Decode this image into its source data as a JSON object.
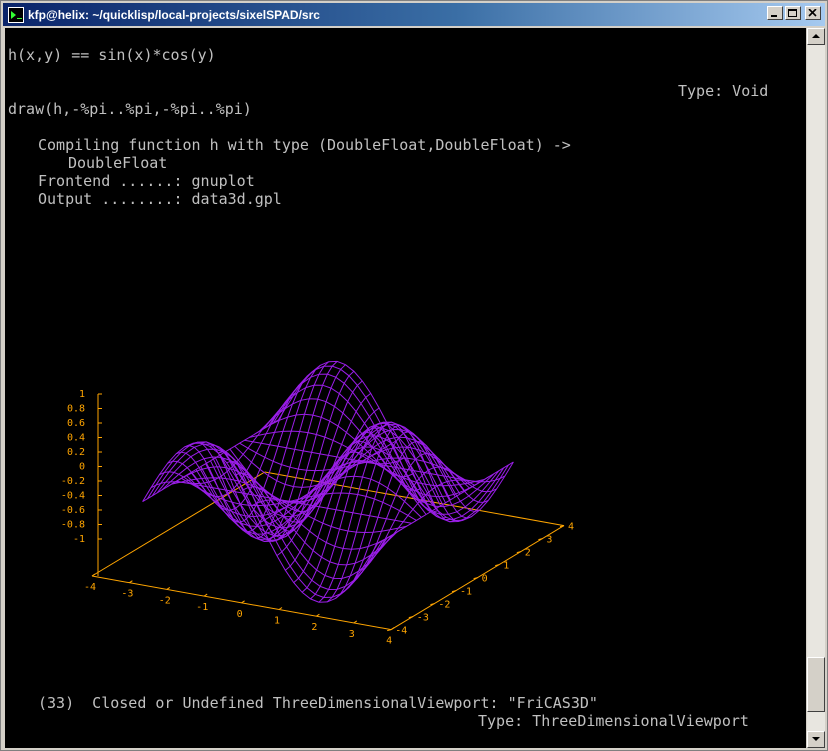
{
  "window": {
    "title": "kfp@helix: ~/quicklisp/local-projects/sixelSPAD/src"
  },
  "terminal": {
    "lines": [
      "h(x,y) == sin(x)*cos(y)",
      "Type: Void",
      "draw(h,-%pi..%pi,-%pi..%pi)",
      "Compiling function h with type (DoubleFloat,DoubleFloat) ->",
      "DoubleFloat",
      "Frontend ......: gnuplot",
      "Output ........: data3d.gpl",
      "(33)  Closed or Undefined ThreeDimensionalViewport: \"FriCAS3D\"",
      "Type: ThreeDimensionalViewport"
    ]
  },
  "colors": {
    "surface": "#9a1ee8",
    "axes": "#ffa500",
    "text": "#c0c0c0",
    "background": "#000000"
  },
  "chart_data": {
    "type": "surface",
    "function": "sin(x)*cos(y)",
    "x_range": [
      -3.14159,
      3.14159
    ],
    "y_range": [
      -3.14159,
      3.14159
    ],
    "zlim": [
      -1,
      1
    ],
    "z_ticks": [
      "1",
      "0.8",
      "0.6",
      "0.4",
      "0.2",
      "0",
      "-0.2",
      "-0.4",
      "-0.6",
      "-0.8",
      "-1"
    ],
    "x_ticks": [
      "-4",
      "-3",
      "-2",
      "-1",
      "0",
      "1",
      "2",
      "3",
      "4"
    ],
    "y_ticks": [
      "-4",
      "-3",
      "-2",
      "-1",
      "0",
      "1",
      "2",
      "3",
      "4"
    ],
    "grid_samples": 29
  }
}
